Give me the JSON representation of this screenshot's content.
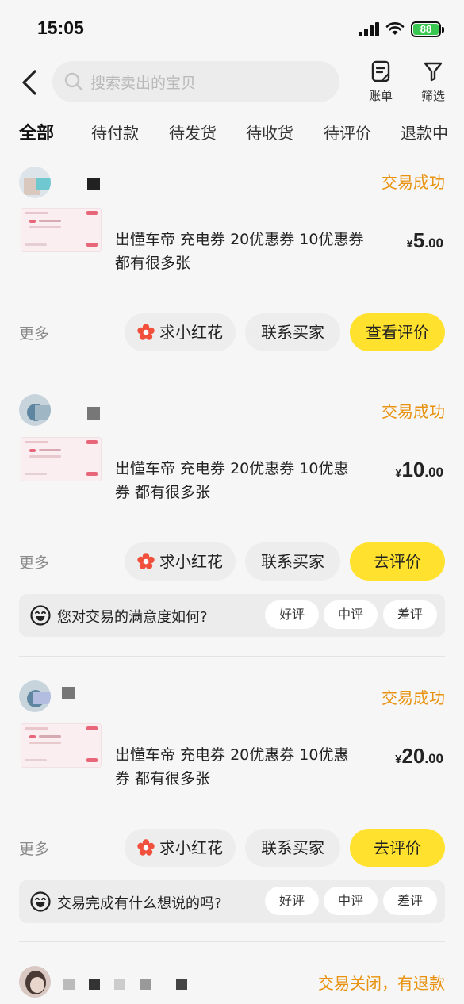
{
  "status_bar": {
    "time": "15:05",
    "battery": "88"
  },
  "header": {
    "search_placeholder": "搜索卖出的宝贝",
    "bill_label": "账单",
    "filter_label": "筛选"
  },
  "tabs": [
    "全部",
    "待付款",
    "待发货",
    "待收货",
    "待评价",
    "退款中"
  ],
  "orders": [
    {
      "status": "交易成功",
      "title_line1": "出懂车帝 充电券 20优惠券 10优惠券",
      "title_line2": "都有很多张",
      "price_symbol": "¥",
      "price_int": "5",
      "price_dec": ".00",
      "more": "更多",
      "btn_flower": "求小红花",
      "btn_contact": "联系买家",
      "btn_primary": "查看评价"
    },
    {
      "status": "交易成功",
      "title_line1": "出懂车帝 充电券 20优惠券 10优惠",
      "title_line2": "券 都有很多张",
      "price_symbol": "¥",
      "price_int": "10",
      "price_dec": ".00",
      "more": "更多",
      "btn_flower": "求小红花",
      "btn_contact": "联系买家",
      "btn_primary": "去评价",
      "rating_question": "您对交易的满意度如何?",
      "rating_options": [
        "好评",
        "中评",
        "差评"
      ]
    },
    {
      "status": "交易成功",
      "title_line1": "出懂车帝 充电券 20优惠券 10优惠",
      "title_line2": "券 都有很多张",
      "price_symbol": "¥",
      "price_int": "20",
      "price_dec": ".00",
      "more": "更多",
      "btn_flower": "求小红花",
      "btn_contact": "联系买家",
      "btn_primary": "去评价",
      "rating_question": "交易完成有什么想说的吗?",
      "rating_options": [
        "好评",
        "中评",
        "差评"
      ]
    },
    {
      "status": "交易关闭，有退款"
    }
  ],
  "colors": {
    "accent_yellow": "#ffe12e",
    "status_orange": "#e8920f",
    "flower_red": "#f0503c"
  }
}
